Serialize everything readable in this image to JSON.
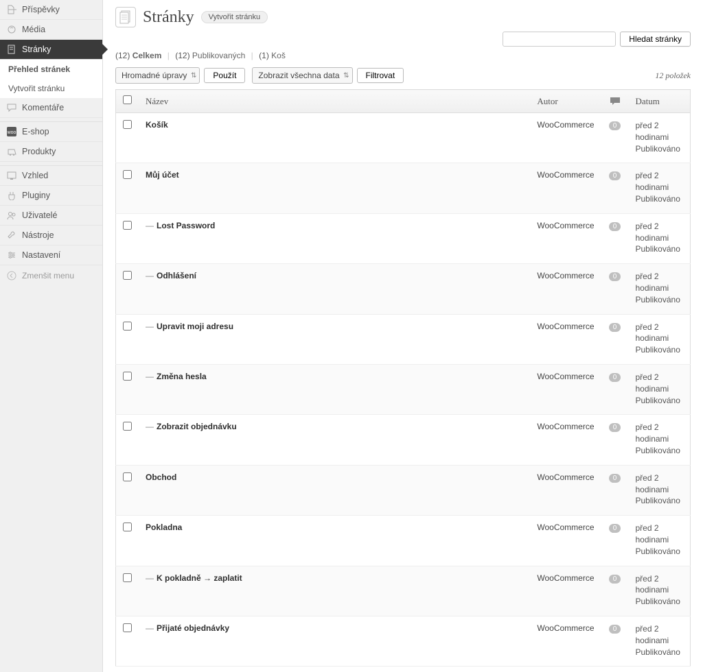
{
  "sidebar": {
    "items": [
      {
        "key": "posts",
        "label": "Příspěvky"
      },
      {
        "key": "media",
        "label": "Média"
      },
      {
        "key": "pages",
        "label": "Stránky"
      },
      {
        "key": "comments",
        "label": "Komentáře"
      },
      {
        "key": "eshop",
        "label": "E-shop"
      },
      {
        "key": "products",
        "label": "Produkty"
      },
      {
        "key": "appearance",
        "label": "Vzhled"
      },
      {
        "key": "plugins",
        "label": "Pluginy"
      },
      {
        "key": "users",
        "label": "Uživatelé"
      },
      {
        "key": "tools",
        "label": "Nástroje"
      },
      {
        "key": "settings",
        "label": "Nastavení"
      }
    ],
    "sub": [
      {
        "label": "Přehled stránek"
      },
      {
        "label": "Vytvořit stránku"
      }
    ],
    "collapse": "Zmenšit menu"
  },
  "header": {
    "title": "Stránky",
    "create_btn": "Vytvořit stránku"
  },
  "search": {
    "placeholder": "",
    "button": "Hledat stránky"
  },
  "views": {
    "total_count": "12",
    "total_label": "Celkem",
    "pub_count": "12",
    "pub_label": "Publikovaných",
    "trash_count": "1",
    "trash_label": "Koš"
  },
  "toolbar": {
    "bulk": "Hromadné úpravy",
    "apply": "Použít",
    "dates": "Zobrazit všechna data",
    "filter": "Filtrovat",
    "count": "12 položek"
  },
  "table": {
    "headers": {
      "name": "Název",
      "author": "Autor",
      "date": "Datum"
    },
    "rows": [
      {
        "indent": 0,
        "title": "Košík",
        "author": "WooCommerce",
        "comments": "0",
        "date1": "před 2 hodinami",
        "date2": "Publikováno"
      },
      {
        "indent": 0,
        "title": "Můj účet",
        "author": "WooCommerce",
        "comments": "0",
        "date1": "před 2 hodinami",
        "date2": "Publikováno"
      },
      {
        "indent": 1,
        "title": "Lost Password",
        "author": "WooCommerce",
        "comments": "0",
        "date1": "před 2 hodinami",
        "date2": "Publikováno"
      },
      {
        "indent": 1,
        "title": "Odhlášení",
        "author": "WooCommerce",
        "comments": "0",
        "date1": "před 2 hodinami",
        "date2": "Publikováno"
      },
      {
        "indent": 1,
        "title": "Upravit moji adresu",
        "author": "WooCommerce",
        "comments": "0",
        "date1": "před 2 hodinami",
        "date2": "Publikováno"
      },
      {
        "indent": 1,
        "title": "Změna hesla",
        "author": "WooCommerce",
        "comments": "0",
        "date1": "před 2 hodinami",
        "date2": "Publikováno"
      },
      {
        "indent": 1,
        "title": "Zobrazit objednávku",
        "author": "WooCommerce",
        "comments": "0",
        "date1": "před 2 hodinami",
        "date2": "Publikováno"
      },
      {
        "indent": 0,
        "title": "Obchod",
        "author": "WooCommerce",
        "comments": "0",
        "date1": "před 2 hodinami",
        "date2": "Publikováno"
      },
      {
        "indent": 0,
        "title": "Pokladna",
        "author": "WooCommerce",
        "comments": "0",
        "date1": "před 2 hodinami",
        "date2": "Publikováno"
      },
      {
        "indent": 1,
        "title": "K pokladně → zaplatit",
        "author": "WooCommerce",
        "comments": "0",
        "date1": "před 2 hodinami",
        "date2": "Publikováno"
      },
      {
        "indent": 1,
        "title": "Přijaté objednávky",
        "author": "WooCommerce",
        "comments": "0",
        "date1": "před 2 hodinami",
        "date2": "Publikováno"
      }
    ]
  }
}
